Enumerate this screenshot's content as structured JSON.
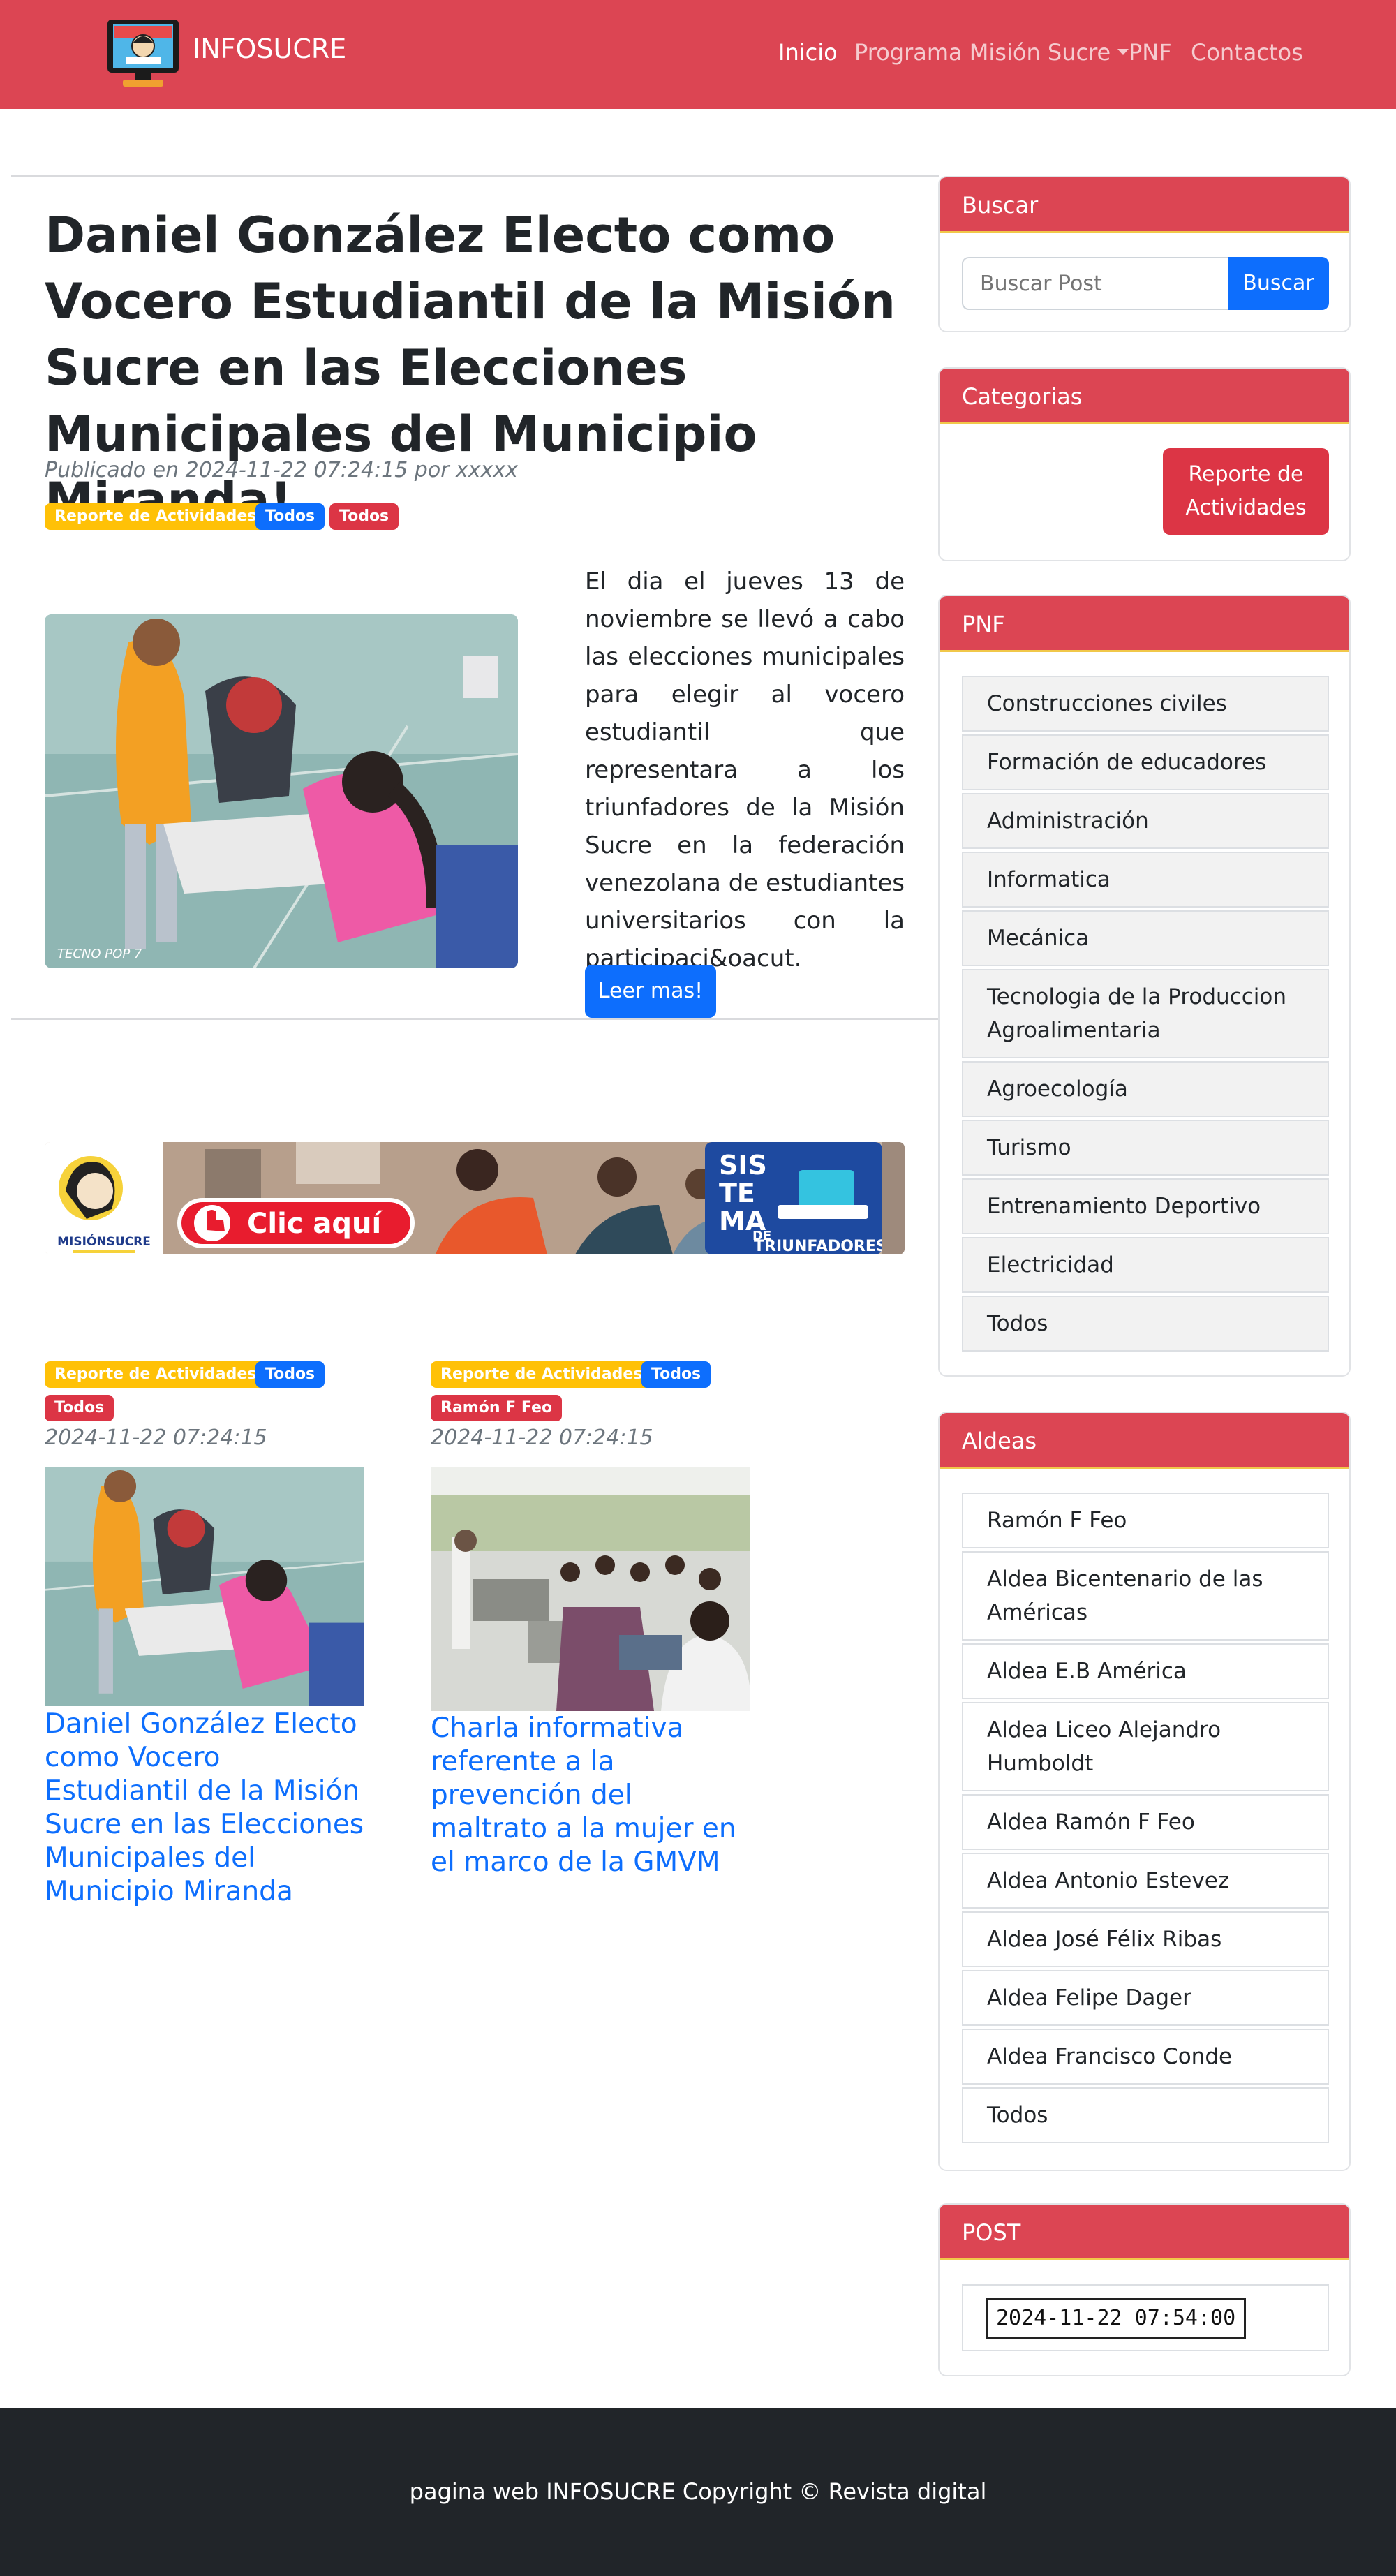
{
  "navbar": {
    "brand": "INFOSUCRE",
    "links": [
      "Inicio",
      "Programa Misión Sucre",
      "PNF",
      "Contactos"
    ]
  },
  "post": {
    "title": "Daniel González Electo como Vocero Estudiantil de la Misión Sucre en las Elecciones Municipales del Municipio Miranda!",
    "meta": "Publicado en 2024-11-22 07:24:15 por xxxxx",
    "badges": [
      "Reporte de Actividades",
      "Todos",
      "Todos"
    ],
    "excerpt": "El dia el jueves 13 de noviembre se llevó a cabo las elecciones municipales para elegir al vocero estudiantil que representara a los triunfadores de la Misión Sucre en la federación venezolana de estudiantes universitarios con la participaci&oacut.",
    "read_more": "Leer mas!",
    "photo_watermark": "TECNO POP 7"
  },
  "banner": {
    "logo_text": "MISIÓNSUCRE",
    "cta": "Clic aquí",
    "sistema": [
      "SIS",
      "TE",
      "MA",
      "DE",
      "TRIUNFADORES"
    ]
  },
  "cards": [
    {
      "badges": [
        "Reporte de Actividades",
        "Todos",
        "Todos"
      ],
      "date": "2024-11-22 07:24:15",
      "title": "Daniel González Electo como Vocero Estudiantil de la Misión Sucre en las Elecciones Municipales del Municipio Miranda"
    },
    {
      "badges": [
        "Reporte de Actividades",
        "Todos",
        "Ramón F Feo"
      ],
      "date": "2024-11-22 07:24:15",
      "title": "Charla informativa referente a la prevención del maltrato a la mujer en el marco de la GMVM"
    }
  ],
  "sidebar": {
    "search": {
      "title": "Buscar",
      "placeholder": "Buscar Post",
      "button": "Buscar"
    },
    "categories": {
      "title": "Categorias",
      "items": [
        "Reporte de Actividades"
      ]
    },
    "pnf": {
      "title": "PNF",
      "items": [
        "Construcciones civiles",
        "Formación de educadores",
        "Administración",
        "Informatica",
        "Mecánica",
        "Tecnologia de la Produccion Agroalimentaria",
        "Agroecología",
        "Turismo",
        "Entrenamiento Deportivo",
        "Electricidad",
        "Todos"
      ]
    },
    "aldeas": {
      "title": "Aldeas",
      "items": [
        "Ramón F Feo",
        "Aldea Bicentenario de las Américas",
        "Aldea E.B América",
        "Aldea Liceo Alejandro Humboldt",
        "Aldea Ramón F Feo",
        "Aldea Antonio Estevez",
        "Aldea José Félix Ribas",
        "Aldea Felipe Dager",
        "Aldea Francisco Conde",
        "Todos"
      ]
    },
    "post": {
      "title": "POST",
      "value": "2024-11-22 07:54:00"
    }
  },
  "footer": {
    "text": "pagina web INFOSUCRE Copyright © Revista digital"
  },
  "colors": {
    "navbar": "#dc4553",
    "primary": "#0d6efd",
    "warning": "#ffc107",
    "danger": "#dc3545",
    "footer": "#212529"
  }
}
